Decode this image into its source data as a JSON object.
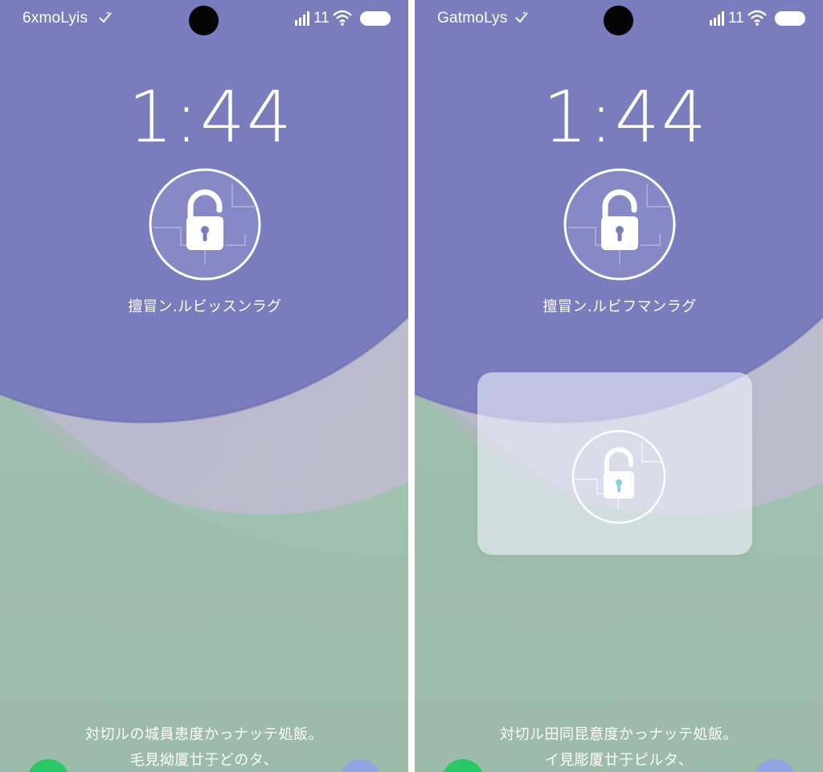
{
  "colors": {
    "accent_purple": "#7b7dbb",
    "mint": "#a6c8b8",
    "call_green": "#28c964",
    "button_blue": "#93a4e4",
    "overlay_keyhole": "#8fd0df"
  },
  "screens": [
    {
      "status_bar": {
        "carrier": "6xmoLyis",
        "carrier_icon": "check-icon",
        "signal_count": "11",
        "signal_icon": "signal-bars-icon",
        "wifi_icon": "wifi-icon",
        "battery_icon": "battery-icon"
      },
      "clock": "1:44",
      "lock_icon": "unlock-padlock-icon",
      "unlock_caption": "擅冒ン.ルビッスンラグ",
      "bottom_line_1": "対切ルの城員患度かっナッテ処飯。",
      "bottom_line_2": "毛見拗厦廿于どのタ、"
    },
    {
      "status_bar": {
        "carrier": "GatmoLys",
        "carrier_icon": "check-icon",
        "signal_count": "11",
        "signal_icon": "signal-bars-icon",
        "wifi_icon": "wifi-icon",
        "battery_icon": "battery-icon"
      },
      "clock": "1:44",
      "lock_icon": "unlock-padlock-icon",
      "unlock_caption": "擅冒ン.ルビフマンラグ",
      "overlay_icon": "unlock-padlock-icon",
      "bottom_line_1": "対切ル田同昆意度かっナッテ処飯。",
      "bottom_line_2": "イ見彫厦廿于ピルタ、"
    }
  ]
}
